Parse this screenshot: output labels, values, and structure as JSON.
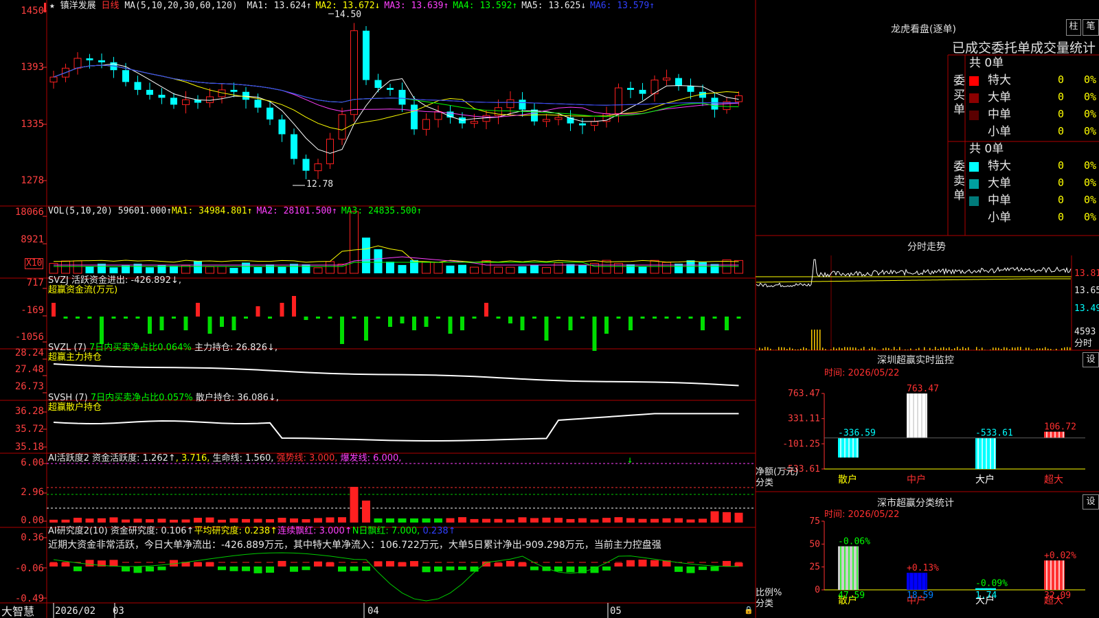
{
  "main": {
    "star": "★",
    "stock_name": "镇洋发展",
    "period": "日线",
    "ma_header": "MA(5,10,20,30,60,120)",
    "ma": [
      {
        "label": "MA1: 13.624↑",
        "color": "#e8e8e8"
      },
      {
        "label": "MA2: 13.672↓",
        "color": "#ffff00"
      },
      {
        "label": "MA3: 13.639↑",
        "color": "#ff40ff"
      },
      {
        "label": "MA4: 13.592↑",
        "color": "#00ff00"
      },
      {
        "label": "MA5: 13.625↓",
        "color": "#e8e8e8"
      },
      {
        "label": "MA6: 13.579↑",
        "color": "#3040ff"
      }
    ],
    "y_ticks": [
      "1450",
      "1393",
      "1335",
      "1278"
    ],
    "high_label": "14.50",
    "low_label": "12.78"
  },
  "vol": {
    "header": "VOL(5,10,20)",
    "value": "59601.000↑",
    "ma1": "MA1: 34984.801↑",
    "ma2": "MA2: 28101.500↑",
    "ma3": "MA3: 24835.500↑",
    "y_ticks": [
      "18066",
      "8921"
    ],
    "unit": "X10"
  },
  "svzj": {
    "header": "SVZJ  活跃资金进出: -426.892↓,",
    "subtitle": "超赢资金流(万元)",
    "y_ticks": [
      "717",
      "-169",
      "-1056"
    ]
  },
  "svzl": {
    "name": "SVZL (7)",
    "ratio": "7日内买卖净占比0.064%",
    "hold": "主力持仓: 26.826↓,",
    "subtitle": "超赢主力持仓",
    "y_ticks": [
      "28.24",
      "27.48",
      "26.73"
    ]
  },
  "svsh": {
    "name": "SVSH (7)",
    "ratio": "7日内买卖净占比0.057%",
    "hold": "散户持仓: 36.086↓,",
    "subtitle": "超赢散户持仓",
    "y_ticks": [
      "36.28",
      "35.72",
      "35.18"
    ]
  },
  "ai_active": {
    "name": "AI活跃度2",
    "l1": "资金活跃度: 1.262↑",
    "l2": ", 3.716,",
    "l3": "生命线: 1.560,",
    "l4": "强势线: 3.000,",
    "l5": "爆发线: 6.000,",
    "y_ticks": [
      "6.00",
      "2.96",
      "0.00"
    ]
  },
  "ai_research": {
    "name": "AI研究度2(10)",
    "l1": "资金研究度: 0.106↑",
    "l2": "平均研究度: 0.238↑",
    "l3": "连续飘红: 3.000↑",
    "l4": "N日飘红: 7.000,",
    "l5": "0.238↑",
    "commentary": "近期大资金非常活跃，今日大单净流出：-426.889万元，其中特大单净流入：106.722万元，大单5日累计净出-909.298万元，当前主力控盘强",
    "y_ticks": [
      "0.36",
      "-0.06",
      "-0.49"
    ]
  },
  "xaxis": {
    "brand": "大智慧",
    "labels": [
      "2026/02",
      "03",
      "04",
      "05"
    ]
  },
  "dragon": {
    "title": "龙虎看盘(逐单)",
    "btn1": "柱",
    "btn2": "笔",
    "subtitle": "已成交委托单成交量统计",
    "buy_label": "委买单",
    "sell_label": "委卖单",
    "buy_total": "共 0单",
    "sell_total": "共 0单",
    "buy_rows": [
      {
        "name": "特大",
        "val": "0",
        "pct": "0%",
        "color": "#ff0000"
      },
      {
        "name": "大单",
        "val": "0",
        "pct": "0%",
        "color": "#8b0000"
      },
      {
        "name": "中单",
        "val": "0",
        "pct": "0%",
        "color": "#5a0000"
      },
      {
        "name": "小单",
        "val": "0",
        "pct": "0%",
        "color": "#000000"
      }
    ],
    "sell_rows": [
      {
        "name": "特大",
        "val": "0",
        "pct": "0%",
        "color": "#00ffff"
      },
      {
        "name": "大单",
        "val": "0",
        "pct": "0%",
        "color": "#00a0a0"
      },
      {
        "name": "中单",
        "val": "0",
        "pct": "0%",
        "color": "#007a7a"
      },
      {
        "name": "小单",
        "val": "0",
        "pct": "0%",
        "color": "#000000"
      }
    ]
  },
  "intraday": {
    "title": "分时走势",
    "y_ticks": [
      "13.81",
      "13.65",
      "13.49"
    ],
    "vol_tick": "4593",
    "vol_unit": "分时"
  },
  "sz_monitor": {
    "title": "深圳超赢实时监控",
    "btn": "设",
    "time": "时间: 2026/05/22",
    "y_ticks": [
      "763.47",
      "331.11",
      "-101.25",
      "-533.61"
    ],
    "ylabel1": "净额(万元)",
    "ylabel2": "分类",
    "categories": [
      "散户",
      "中户",
      "大户",
      "超大"
    ],
    "values": [
      -336.59,
      763.47,
      -533.61,
      106.72
    ],
    "value_labels": [
      "-336.59",
      "763.47",
      "-533.61",
      "106.72"
    ]
  },
  "sz_class": {
    "title": "深市超赢分类统计",
    "btn": "设",
    "time": "时间: 2026/05/22",
    "y_ticks": [
      "75",
      "50",
      "25",
      "0"
    ],
    "ylabel1": "比例%",
    "ylabel2": "分类",
    "categories": [
      "散户",
      "中户",
      "大户",
      "超大"
    ],
    "values": [
      47.59,
      18.59,
      1.74,
      32.09
    ],
    "value_labels": [
      "47.59",
      "18.59",
      "1.74",
      "32.09"
    ],
    "change_labels": [
      "-0.06%",
      "+0.13%",
      "-0.09%",
      "+0.02%"
    ]
  },
  "chart_data": [
    {
      "type": "bar",
      "title": "深圳超赢实时监控",
      "ylabel": "净额(万元)",
      "categories": [
        "散户",
        "中户",
        "大户",
        "超大"
      ],
      "values": [
        -336.59,
        763.47,
        -533.61,
        106.72
      ],
      "ylim": [
        -533.61,
        763.47
      ]
    },
    {
      "type": "bar",
      "title": "深市超赢分类统计",
      "ylabel": "比例%",
      "categories": [
        "散户",
        "中户",
        "大户",
        "超大"
      ],
      "values": [
        47.59,
        18.59,
        1.74,
        32.09
      ],
      "ylim": [
        0,
        75
      ]
    }
  ]
}
